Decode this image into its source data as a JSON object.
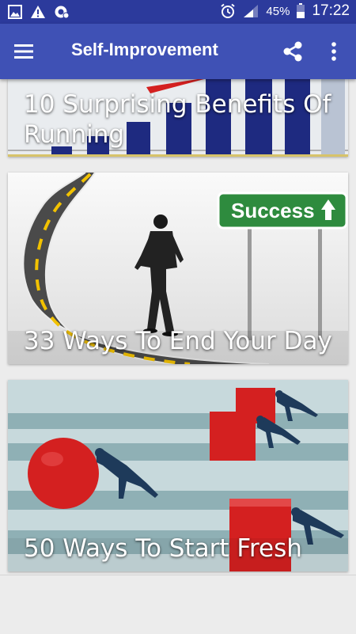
{
  "status_bar": {
    "battery": "45%",
    "time": "17:22",
    "icons": [
      "gallery-icon",
      "warning-icon",
      "data-saver-icon",
      "alarm-icon",
      "signal-icon",
      "battery-icon"
    ]
  },
  "app_bar": {
    "title": "Self-Improvement",
    "menu_icon": "hamburger-menu-icon",
    "share_icon": "share-icon",
    "more_icon": "more-vertical-icon",
    "color": "#3f51b5"
  },
  "articles": [
    {
      "title": "10 Surprising Benefits Of Running"
    },
    {
      "title": "33 Ways To End Your Day",
      "sign_text": "Success"
    },
    {
      "title": "50 Ways To Start Fresh"
    }
  ],
  "colors": {
    "status_bar": "#2c3a9c",
    "background": "#ececec",
    "accent_red": "#d42020",
    "sign_green": "#2e8b3e"
  }
}
